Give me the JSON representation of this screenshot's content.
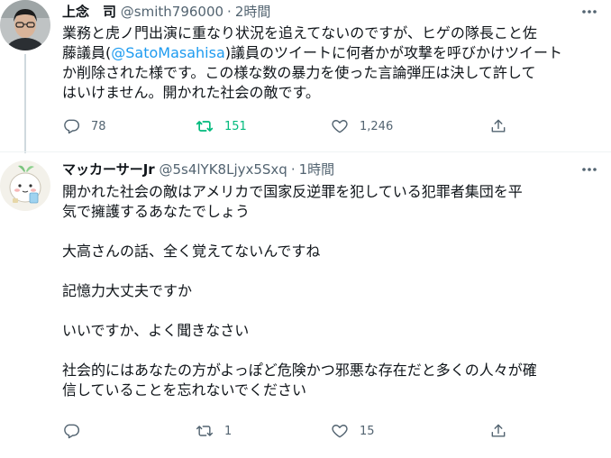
{
  "tweets": [
    {
      "name": "上念　司",
      "handle": "@smith796000",
      "time": "2時間",
      "body_pre": "業務と虎ノ門出演に重なり状況を追えてないのですが、ヒゲの隊長こと佐\n藤議員(",
      "mention": "@SatoMasahisa",
      "body_post": ")議員のツイートに何者かが攻撃を呼びかけツイート\nか削除された様です。この様な数の暴力を使った言論弾圧は決して許して\nはいけません。開かれた社会の敵です。",
      "replies": "78",
      "retweets": "151",
      "likes": "1,246",
      "retweet_active_color": "#00ba7c"
    },
    {
      "name": "マッカーサーJr",
      "handle": "@5s4lYK8Ljyx5Sxq",
      "time": "1時間",
      "body": "開かれた社会の敵はアメリカで国家反逆罪を犯している犯罪者集団を平\n気で擁護するあなたでしょう\n\n大高さんの話、全く覚えてないんですね\n\n記憶力大丈夫ですか\n\nいいですか、よく聞きなさい\n\n社会的にはあなたの方がよっぽど危険かつ邪悪な存在だと多くの人々が確\n信していることを忘れないでください",
      "replies": "",
      "retweets": "1",
      "likes": "15"
    }
  ],
  "icons": [
    "more-icon",
    "reply-icon",
    "retweet-icon",
    "like-icon",
    "share-icon"
  ],
  "colors": {
    "accent": "#1d9bf0",
    "text": "#0f1419",
    "secondary": "#536471",
    "retweet": "#00ba7c"
  }
}
